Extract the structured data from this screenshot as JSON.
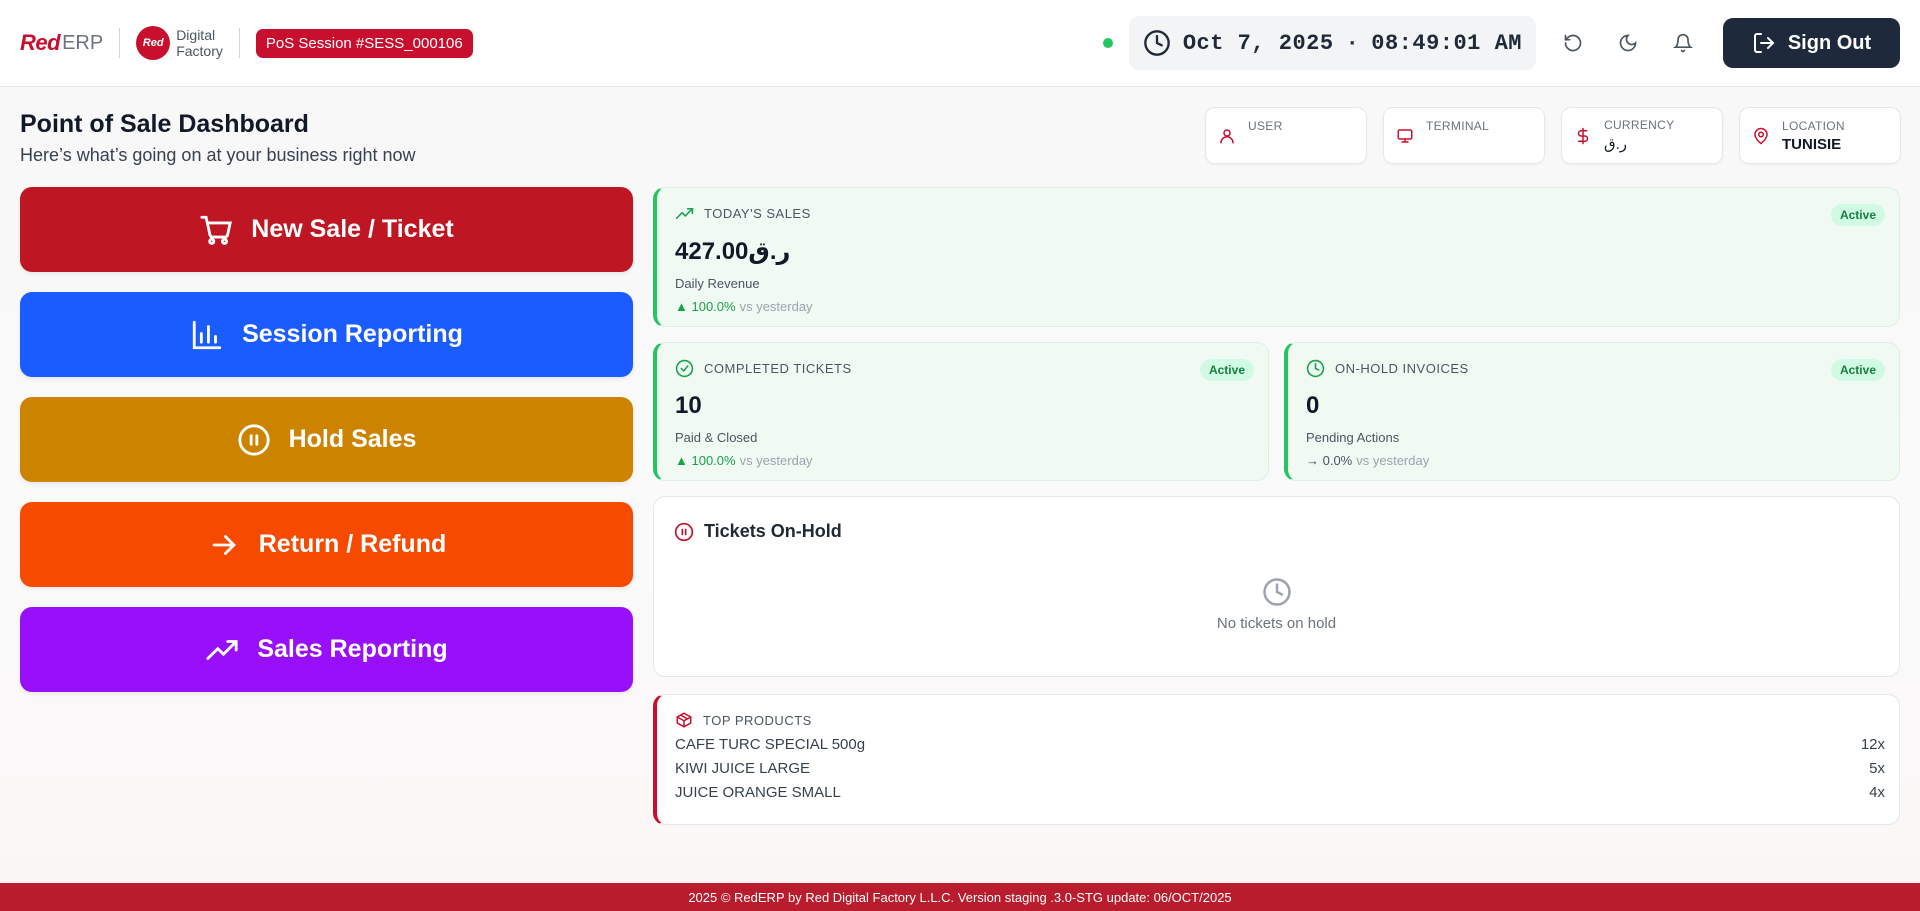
{
  "header": {
    "logo_red": "Red",
    "logo_erp": "ERP",
    "df_logo_mark": "Red",
    "df_line1": "Digital",
    "df_line2": "Factory",
    "session_badge": "PoS Session #SESS_000106",
    "clock_date": "Oct 7, 2025",
    "clock_sep": "·",
    "clock_time": "08:49:01 AM",
    "signout_label": "Sign Out",
    "status_color": "#22c55e"
  },
  "page": {
    "title": "Point of Sale Dashboard",
    "subtitle": "Here’s what’s going on at your business right now"
  },
  "info": {
    "user_label": "USER",
    "user_value": "",
    "terminal_label": "TERMINAL",
    "terminal_value": "",
    "currency_label": "CURRENCY",
    "currency_value": "ر.ق",
    "location_label": "LOCATION",
    "location_value": "TUNISIE"
  },
  "actions": [
    {
      "label": "New Sale / Ticket",
      "color": "#be1622",
      "icon": "cart-icon"
    },
    {
      "label": "Session Reporting",
      "color": "#1a5cff",
      "icon": "bar-chart-icon"
    },
    {
      "label": "Hold Sales",
      "color": "#cc8400",
      "icon": "pause-circle-icon"
    },
    {
      "label": "Return / Refund",
      "color": "#f54a00",
      "icon": "arrow-right-icon"
    },
    {
      "label": "Sales Reporting",
      "color": "#9810fa",
      "icon": "trending-up-icon"
    }
  ],
  "stats": {
    "today": {
      "label": "TODAY'S SALES",
      "badge": "Active",
      "value": "427.00ر.ق",
      "sub": "Daily Revenue",
      "trend": "▲ 100.0%",
      "vs": "vs yesterday"
    },
    "completed": {
      "label": "COMPLETED TICKETS",
      "badge": "Active",
      "value": "10",
      "sub": "Paid & Closed",
      "trend": "▲ 100.0%",
      "vs": "vs yesterday"
    },
    "onhold": {
      "label": "ON-HOLD INVOICES",
      "badge": "Active",
      "value": "0",
      "sub": "Pending Actions",
      "trend": "→ 0.0%",
      "vs": "vs yesterday"
    }
  },
  "tickets_panel": {
    "title": "Tickets On-Hold",
    "empty": "No tickets on hold"
  },
  "top_products": {
    "label": "TOP PRODUCTS",
    "items": [
      {
        "name": "CAFE TURC SPECIAL 500g",
        "qty": "12x"
      },
      {
        "name": "KIWI JUICE LARGE",
        "qty": "5x"
      },
      {
        "name": "JUICE ORANGE SMALL",
        "qty": "4x"
      }
    ]
  },
  "footer": {
    "text": "2025 © RedERP by Red Digital Factory L.L.C. Version staging .3.0-STG update: 06/OCT/2025"
  }
}
